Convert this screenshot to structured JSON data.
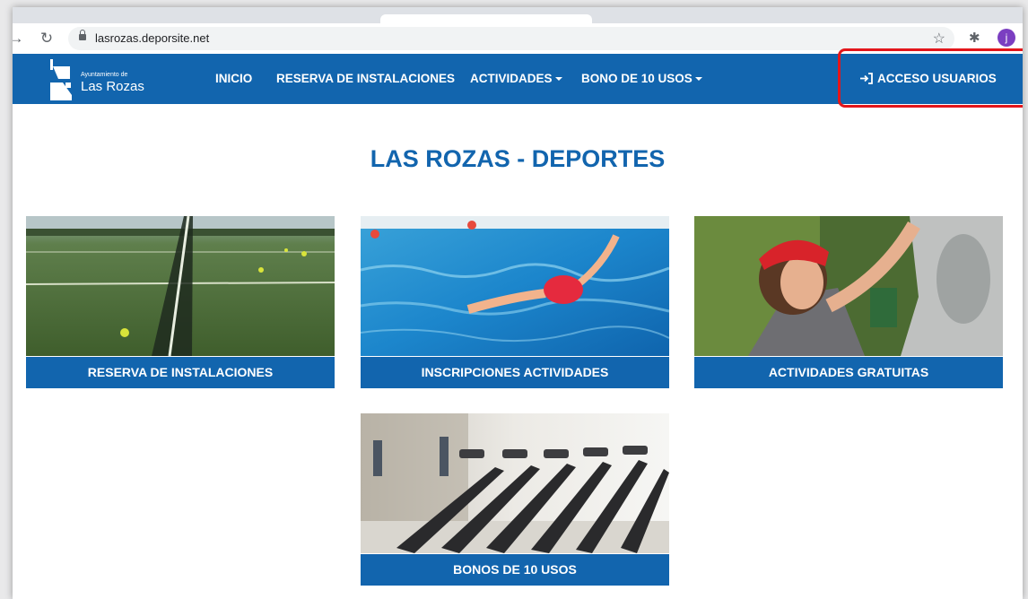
{
  "browser": {
    "url": "lasrozas.deporsite.net",
    "profile_initial": "j"
  },
  "site": {
    "logo": {
      "small": "Ayuntamiento de",
      "big": "Las Rozas"
    },
    "nav": [
      {
        "label": "INICIO",
        "dropdown": false
      },
      {
        "label": "RESERVA DE INSTALACIONES",
        "dropdown": false
      },
      {
        "label": "ACTIVIDADES",
        "dropdown": true
      },
      {
        "label": "BONO DE 10 USOS",
        "dropdown": true
      }
    ],
    "login_label": "ACCESO USUARIOS",
    "title": "LAS ROZAS - DEPORTES",
    "colors": {
      "brand": "#1265ae",
      "highlight": "#e3161b"
    }
  },
  "cards": [
    {
      "label": "RESERVA DE INSTALACIONES",
      "image": "padel-court-image"
    },
    {
      "label": "INSCRIPCIONES ACTIVIDADES",
      "image": "swimming-pool-image"
    },
    {
      "label": "ACTIVIDADES GRATUITAS",
      "image": "climbing-wall-image"
    },
    {
      "label": "BONOS DE 10 USOS",
      "image": "gym-treadmills-image"
    }
  ]
}
